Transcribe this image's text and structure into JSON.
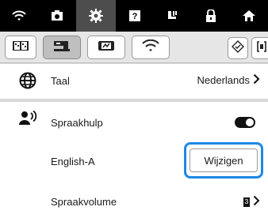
{
  "topbar": {
    "icons": [
      "wifi-icon",
      "camera-icon",
      "gear-icon",
      "help-icon",
      "foot-icon",
      "lock-icon",
      "home-icon"
    ],
    "active": "gear-icon"
  },
  "tabs": [
    {
      "name": "embroidery-book-tab-icon"
    },
    {
      "name": "sewing-machine-tab-icon"
    },
    {
      "name": "embroidery-frame-tab-icon"
    },
    {
      "name": "wifi-tab-icon"
    },
    {
      "name": "diamond-tab-icon"
    },
    {
      "name": "bracket-tab-icon"
    }
  ],
  "settings": {
    "language": {
      "label": "Taal",
      "value": "Nederlands"
    },
    "voice": {
      "label": "Spraakhulp",
      "toggle_on": true
    },
    "voice_lang": {
      "label": "English-A",
      "button": "Wijzigen"
    },
    "volume": {
      "label": "Spraakvolume",
      "value": "3"
    }
  }
}
